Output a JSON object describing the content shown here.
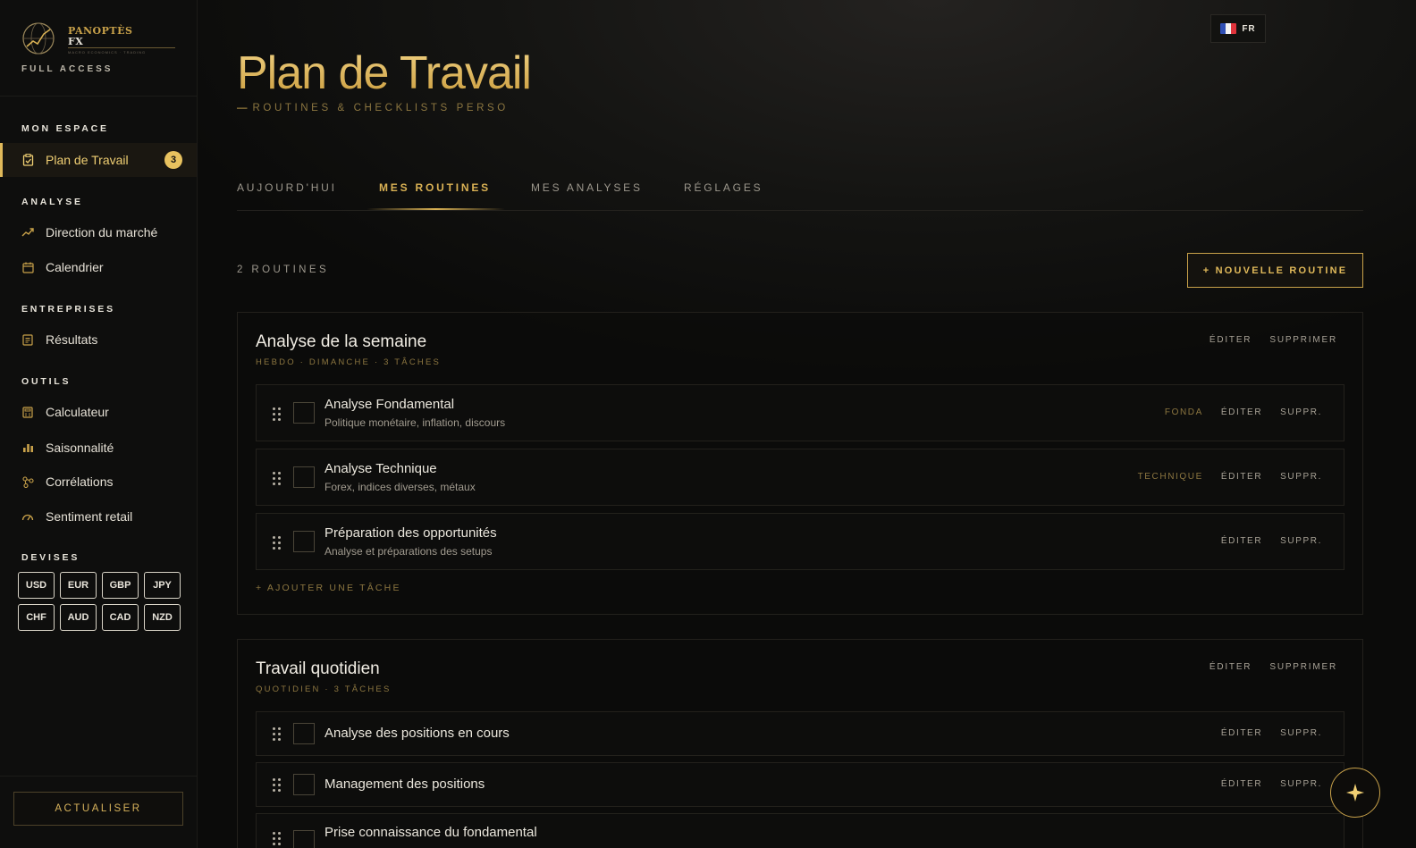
{
  "brand": {
    "name_top": "PANOPTÈS",
    "name_bottom": "FX",
    "tagline": "MACRO ECONOMICS · TRADING",
    "access": "FULL ACCESS"
  },
  "sidebar": {
    "sections": [
      {
        "title": "MON ESPACE"
      },
      {
        "title": "ANALYSE"
      },
      {
        "title": "ENTREPRISES"
      },
      {
        "title": "OUTILS"
      },
      {
        "title": "DEVISES"
      }
    ],
    "items": [
      {
        "label": "Plan de Travail",
        "icon": "clipboard-check-icon",
        "badge": "3"
      },
      {
        "label": "Direction du marché",
        "icon": "trending-up-icon"
      },
      {
        "label": "Calendrier",
        "icon": "calendar-icon"
      },
      {
        "label": "Résultats",
        "icon": "report-icon"
      },
      {
        "label": "Calculateur",
        "icon": "calculator-icon"
      },
      {
        "label": "Saisonnalité",
        "icon": "bar-chart-icon"
      },
      {
        "label": "Corrélations",
        "icon": "network-icon"
      },
      {
        "label": "Sentiment retail",
        "icon": "gauge-icon"
      }
    ],
    "currencies": [
      "USD",
      "EUR",
      "GBP",
      "JPY",
      "CHF",
      "AUD",
      "CAD",
      "NZD"
    ],
    "refresh_label": "ACTUALISER"
  },
  "header": {
    "lang": "FR",
    "title": "Plan de Travail",
    "subtitle": "ROUTINES & CHECKLISTS PERSO"
  },
  "tabs": [
    {
      "label": "AUJOURD'HUI"
    },
    {
      "label": "MES ROUTINES",
      "active": true
    },
    {
      "label": "MES ANALYSES"
    },
    {
      "label": "RÉGLAGES"
    }
  ],
  "routines_count": "2 ROUTINES",
  "new_routine_label": "+ NOUVELLE ROUTINE",
  "routines": [
    {
      "title": "Analyse de la semaine",
      "meta": "HEBDO · DIMANCHE · 3 TÂCHES",
      "edit": "ÉDITER",
      "delete": "SUPPRIMER",
      "tasks": [
        {
          "title": "Analyse Fondamental",
          "desc": "Politique monétaire, inflation, discours",
          "tag": "FONDA",
          "edit": "ÉDITER",
          "delete": "SUPPR."
        },
        {
          "title": "Analyse Technique",
          "desc": "Forex, indices diverses, métaux",
          "tag": "TECHNIQUE",
          "edit": "ÉDITER",
          "delete": "SUPPR."
        },
        {
          "title": "Préparation des opportunités",
          "desc": "Analyse et préparations des setups",
          "tag": "",
          "edit": "ÉDITER",
          "delete": "SUPPR."
        }
      ],
      "add_task": "+ AJOUTER UNE TÂCHE"
    },
    {
      "title": "Travail quotidien",
      "meta": "QUOTIDIEN · 3 TÂCHES",
      "edit": "ÉDITER",
      "delete": "SUPPRIMER",
      "tasks": [
        {
          "title": "Analyse des positions en cours",
          "edit": "ÉDITER",
          "delete": "SUPPR."
        },
        {
          "title": "Management des positions",
          "edit": "ÉDITER",
          "delete": "SUPPR."
        },
        {
          "title": "Prise connaissance du fondamental"
        }
      ]
    }
  ],
  "colors": {
    "accent": "#d9b154",
    "background": "#0b0b0a",
    "sidebar": "#0e0e0d"
  }
}
